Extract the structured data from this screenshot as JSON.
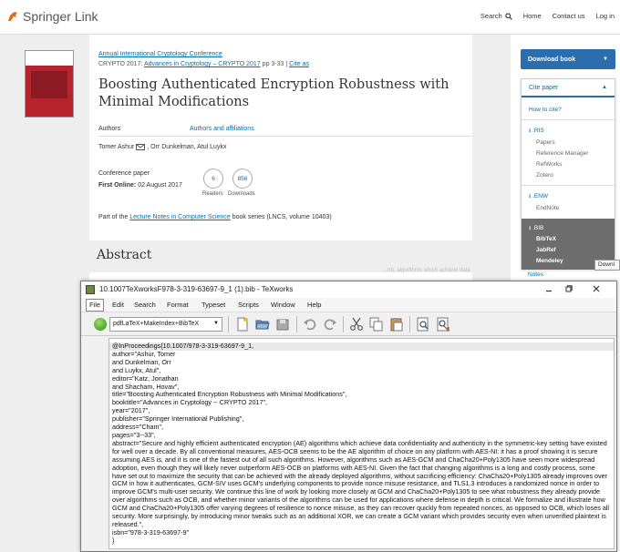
{
  "springer": {
    "logo_text": "Springer",
    "logo_suffix": "Link",
    "nav": {
      "search": "Search",
      "home": "Home",
      "contact": "Contact us",
      "login": "Log in"
    },
    "conference_link": "Annual International Cryptology Conference",
    "chapter_prefix": "CRYPTO 2017:",
    "chapter_book_link": "Advances in Cryptology – CRYPTO 2017",
    "chapter_pages": "pp 3-33",
    "chapter_sep": "|",
    "cite_as": "Cite as",
    "title": "Boosting Authenticated Encryption Robustness with Minimal Modifications",
    "tab_authors": "Authors",
    "tab_affiliations": "Authors and affiliations",
    "author_first": "Tomer Ashur",
    "author_rest": ", Orr Dunkelman, Atul Luykx",
    "paper_type": "Conference paper",
    "first_online_label": "First Online:",
    "first_online_date": "02 August 2017",
    "readers_count": "6",
    "readers_label": "Readers",
    "downloads_count": "856",
    "downloads_label": "Downloads",
    "part_of_prefix": "Part of the",
    "series_link": "Lecture Notes in Computer Science",
    "part_of_suffix": "book series (LNCS, volume 10403)",
    "abstract_heading": "Abstract",
    "faint_text": "...nt), algorithms which achieve data"
  },
  "sidebar": {
    "download_book": "Download book",
    "cite_paper": "Cite paper",
    "how_to_cite": "How to cite?",
    "ris": ".RIS",
    "ris_items": [
      "Papers",
      "Reference Manager",
      "RefWorks",
      "Zotero"
    ],
    "enw": ".ENW",
    "enw_items": [
      "EndNote"
    ],
    "bib": ".BIB",
    "bib_items": [
      "BibTeX",
      "JabRef",
      "Mendeley"
    ],
    "notes": "Notes",
    "tooltip": "Downl"
  },
  "texworks": {
    "window_title": "10.1007TeXworksF978-3-319-63697-9_1 (1).bib - TeXworks",
    "menu": [
      "File",
      "Edit",
      "Search",
      "Format",
      "Typeset",
      "Scripts",
      "Window",
      "Help"
    ],
    "engine": "pdfLaTeX+MakeIndex+BibTeX",
    "editor_text": "@InProceedings{10.1007/978-3-319-63697-9_1,\nauthor=\"Ashur, Tomer\nand Dunkelman, Orr\nand Luykx, Atul\",\neditor=\"Katz, Jonathan\nand Shacham, Hovav\",\ntitle=\"Boosting Authenticated Encryption Robustness with Minimal Modifications\",\nbooktitle=\"Advances in Cryptology -- CRYPTO 2017\",\nyear=\"2017\",\npublisher=\"Springer International Publishing\",\naddress=\"Cham\",\npages=\"3--33\",\nabstract=\"Secure and highly efficient authenticated encryption (AE) algorithms which achieve data confidentiality and authenticity in the symmetric-key setting have existed for well over a decade. By all conventional measures, AES-OCB seems to be the AE algorithm of choice on any platform with AES-NI: it has a proof showing it is secure assuming AES is, and it is one of the fastest out of all such algorithms. However, algorithms such as AES-GCM and ChaCha20+Poly1305 have seen more widespread adoption, even though they will likely never outperform AES-OCB on platforms with AES-NI. Given the fact that changing algorithms is a long and costly process, some have set out to maximize the security that can be achieved with the already deployed algorithms, without sacrificing efficiency: ChaCha20+Poly1305 already improves over GCM in how it authenticates, GCM-SIV uses GCM's underlying components to provide nonce misuse resistance, and TLS1.3 introduces a randomized nonce in order to improve GCM's multi-user security. We continue this line of work by looking more closely at GCM and ChaCha20+Poly1305 to see what robustness they already provide over algorithms such as OCB, and whether minor variants of the algorithms can be used for applications where defense in depth is critical. We formalize and illustrate how GCM and ChaCha20+Poly1305 offer varying degrees of resilience to nonce misuse, as they can recover quickly from repeated nonces, as opposed to OCB, which loses all security. More surprisingly, by introducing minor tweaks such as an additional XOR, we can create a GCM variant which provides security even when unverified plaintext is released.\",\nisbn=\"978-3-319-63697-9\"\n}"
  },
  "colors": {
    "springer_blue": "#0070a8",
    "download_button": "#2b6dad",
    "bib_block": "#6d6d6d",
    "cover_red": "#b8242d"
  }
}
